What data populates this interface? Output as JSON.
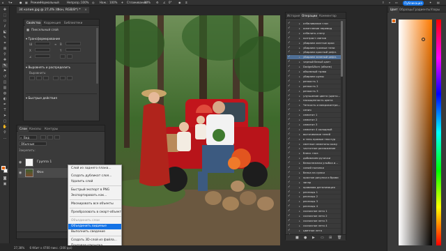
{
  "options_bar": {
    "mode_label": "Режим:",
    "mode_value": "Нормальный",
    "opacity_label": "Непрозр.:",
    "opacity_value": "100%",
    "pressure_label": "Наж.:",
    "pressure_value": "100%",
    "smoothing_label": "Сглаживание:",
    "smoothing_value": "10%",
    "angle_value": "0°",
    "publish_label": "Публикация"
  },
  "document_tab": {
    "title": "34 копия.jpg @ 27,4% (Фон, RGB/8*) *"
  },
  "properties_panel": {
    "tabs": [
      "Свойства",
      "Коррекция",
      "Библиотеки"
    ],
    "layer_type": "Пиксельный слой",
    "transform_title": "Трансформирование",
    "align_title": "Выровнять и распределить",
    "align_label": "Выровнить:",
    "quick_actions_title": "Быстрые действия"
  },
  "layers_panel": {
    "tabs": [
      "Слои",
      "Каналы",
      "Контуры"
    ],
    "kind_label": "Вид",
    "blend_mode": "Обычные",
    "lock_label": "Закрепить:",
    "layers": [
      {
        "name": "Группа 1"
      },
      {
        "name": "Фон"
      }
    ]
  },
  "context_menu": {
    "items": [
      {
        "label": "Слой из заднего плана...",
        "enabled": true,
        "highlighted": false
      },
      {
        "label": "Создать дубликат слоя...",
        "enabled": true,
        "highlighted": false
      },
      {
        "label": "Удалить слой",
        "enabled": true,
        "highlighted": false
      },
      {
        "label": "Быстрый экспорт в PNG",
        "enabled": true,
        "highlighted": false
      },
      {
        "label": "Экспортировать как...",
        "enabled": true,
        "highlighted": false
      },
      {
        "label": "Маскировать все объекты",
        "enabled": true,
        "highlighted": false
      },
      {
        "label": "Преобразовать в смарт-объект",
        "enabled": true,
        "highlighted": false
      },
      {
        "label": "Объединить слои",
        "enabled": false,
        "highlighted": false
      },
      {
        "label": "Объединить видимые",
        "enabled": true,
        "highlighted": true
      },
      {
        "label": "Выполнить сведение",
        "enabled": true,
        "highlighted": false
      },
      {
        "label": "Создать 3D-слой из файла...",
        "enabled": true,
        "highlighted": false
      },
      {
        "label": "Почтовая открытка",
        "enabled": true,
        "highlighted": false
      }
    ]
  },
  "history_panel": {
    "tabs": [
      "История",
      "Операции",
      "Комментар"
    ],
    "items": [
      "отбеливание глаз",
      "осветление перевод",
      "отбелить стену",
      "контраст светов",
      "убираем желтые ярки",
      "убираем грязные тени",
      "убираем красный рефл.",
      "убираем зеленый рефл.",
      "черный белый цвет",
      "Dodge&Burn (объем)",
      "объемный трава",
      "убираем шумы",
      "резкость 1",
      "резкость 2",
      "резкость 3",
      "улучшение цвета (цвето...",
      "насыщенность цвета",
      "Четкость и микроконтра...",
      "сепия",
      "семитон 1",
      "семитон 2",
      "семитон 3",
      "семитон 4 холодный",
      "вытягивание теней",
      "в тень прямые текстур",
      "светлые семитоны кожу",
      "частотное разложение",
      "блеск глаз",
      "добавляем ручочки",
      "белоснежная улыбка и...",
      "синий полянки",
      "белка на сумки",
      "красное рисунки и брови",
      "загар",
      "кровавая детализация",
      "ресницы 1",
      "ресницы 2",
      "ресницы 3",
      "ресницы 4",
      "сказочное лето 1",
      "сказочное лето 2",
      "сказочное лето 3",
      "сказочное лето 4",
      "цветное лето",
      "сказочное лето 5"
    ],
    "selected_index": 7
  },
  "color_panel": {
    "tabs": [
      "Цвет",
      "Образцы",
      "Градиенты",
      "Узоры"
    ],
    "foreground_color": "#e66812",
    "background_color": "#ffffff"
  },
  "status_bar": {
    "zoom": "27,38%",
    "doc_size": "6 Кбит x 4700 пикс. (300 ppi)"
  }
}
